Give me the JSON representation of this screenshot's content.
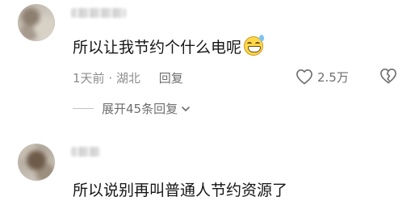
{
  "comments": [
    {
      "text": "所以让我节约个什么电呢",
      "emoji": "grinning-sweat-emoji",
      "time": "1天前",
      "separator": "·",
      "location": "湖北",
      "reply_label": "回复",
      "likes": "2.5万",
      "expand_label": "展开45条回复"
    },
    {
      "text": "所以说别再叫普通人节约资源了"
    }
  ],
  "colors": {
    "text": "#161616",
    "meta": "#8c8c8c",
    "icon": "#6e6e6e",
    "emoji_face": "#ffd84a"
  }
}
